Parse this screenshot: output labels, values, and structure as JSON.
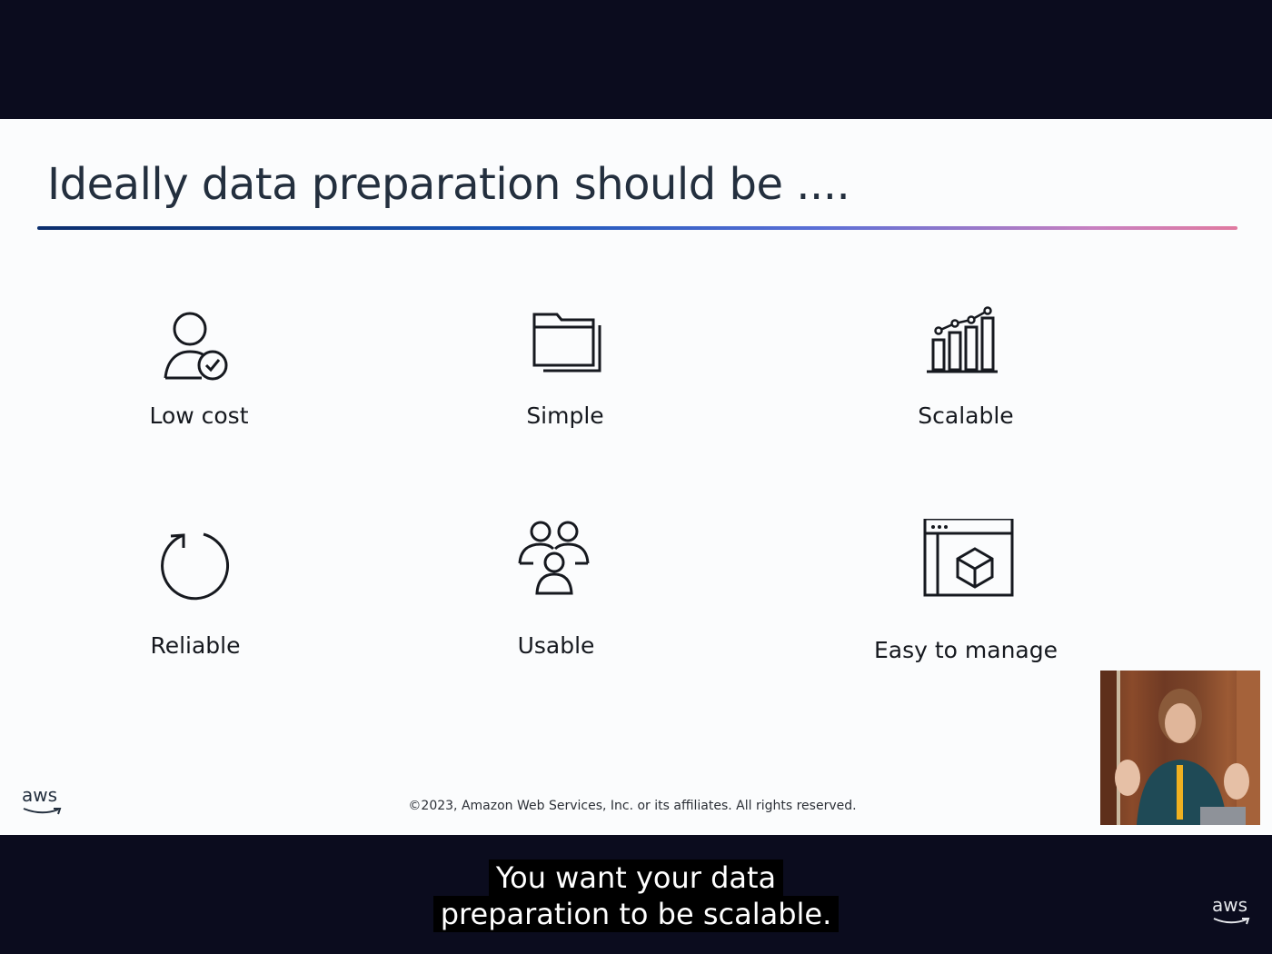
{
  "slide": {
    "title": "Ideally data preparation should be ....",
    "items": [
      {
        "label": "Low cost",
        "icon": "user-check-icon"
      },
      {
        "label": "Simple",
        "icon": "folder-icon"
      },
      {
        "label": "Scalable",
        "icon": "bar-chart-trend-icon"
      },
      {
        "label": "Reliable",
        "icon": "refresh-circle-icon"
      },
      {
        "label": "Usable",
        "icon": "users-group-icon"
      },
      {
        "label": "Easy to manage",
        "icon": "browser-cube-icon"
      }
    ],
    "logo_text": "aws",
    "copyright": "©2023, Amazon Web Services, Inc. or its affiliates. All rights reserved."
  },
  "caption": {
    "lines": [
      "You want your data",
      "preparation to be scalable."
    ]
  },
  "corner_logo_text": "aws",
  "colors": {
    "background_bar": "#0b0c1e",
    "slide_background": "#fbfcfd",
    "title_text": "#232f3e",
    "caption_background": "#000000",
    "caption_text": "#ffffff"
  }
}
